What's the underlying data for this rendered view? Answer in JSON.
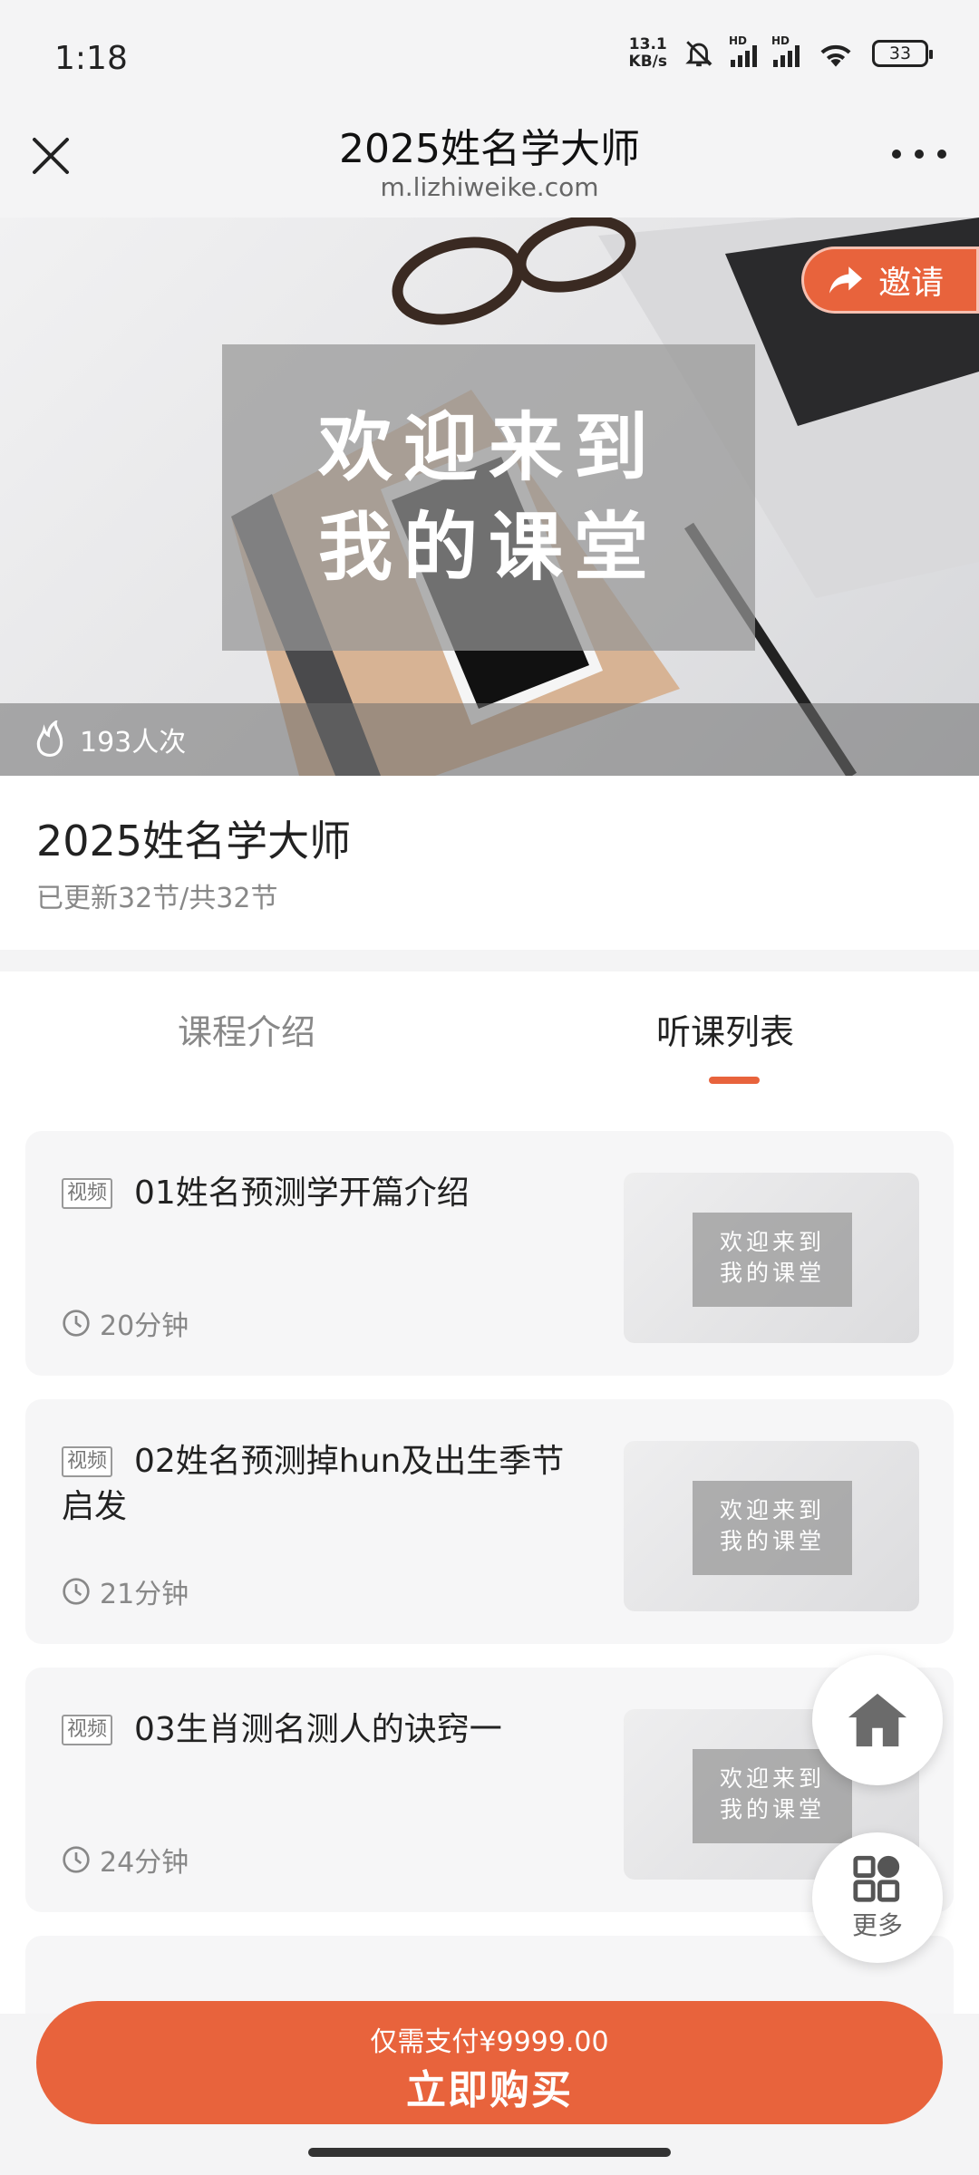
{
  "status_bar": {
    "time": "1:18",
    "net_speed_value": "13.1",
    "net_speed_unit": "KB/s",
    "signal_label": "HD",
    "battery": "33"
  },
  "header": {
    "title": "2025姓名学大师",
    "url": "m.lizhiweike.com"
  },
  "banner": {
    "welcome_line1": "欢迎来到",
    "welcome_line2": "我的课堂",
    "invite_label": "邀请",
    "views": "193人次"
  },
  "course": {
    "title": "2025姓名学大师",
    "update_status": "已更新32节/共32节"
  },
  "tabs": [
    {
      "label": "课程介绍",
      "active": false
    },
    {
      "label": "听课列表",
      "active": true
    }
  ],
  "lessons": [
    {
      "badge": "视频",
      "title": "01姓名预测学开篇介绍",
      "duration": "20分钟",
      "thumb_line1": "欢迎来到",
      "thumb_line2": "我的课堂"
    },
    {
      "badge": "视频",
      "title": "02姓名预测掉hun及出生季节启发",
      "duration": "21分钟",
      "thumb_line1": "欢迎来到",
      "thumb_line2": "我的课堂"
    },
    {
      "badge": "视频",
      "title": "03生肖测名测人的诀窍一",
      "duration": "24分钟",
      "thumb_line1": "欢迎来到",
      "thumb_line2": "我的课堂"
    }
  ],
  "floating": {
    "more_label": "更多"
  },
  "buy_bar": {
    "price_text": "仅需支付¥9999.00",
    "action_label": "立即购买"
  },
  "colors": {
    "accent": "#e8633c",
    "background": "#f4f4f5"
  }
}
